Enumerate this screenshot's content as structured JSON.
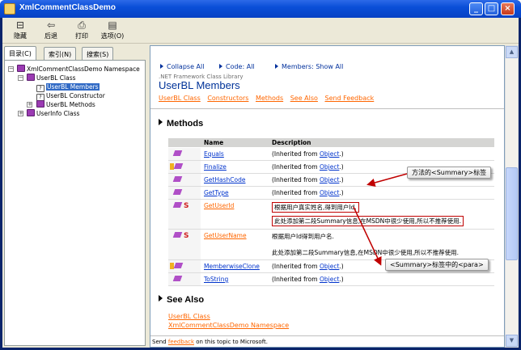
{
  "window": {
    "title": "XmlCommentClassDemo",
    "min": "_",
    "max": "□",
    "close": "×"
  },
  "toolbar": [
    {
      "label": "隐藏",
      "icon": "hide-icon",
      "glyph": "⊟"
    },
    {
      "label": "后退",
      "icon": "back-icon",
      "glyph": "⇦"
    },
    {
      "label": "打印",
      "icon": "print-icon",
      "glyph": "⎙"
    },
    {
      "label": "选项(O)",
      "icon": "options-icon",
      "glyph": "▤"
    }
  ],
  "left": {
    "tabs": [
      "目录(C)",
      "索引(N)",
      "搜索(S)"
    ],
    "tree": [
      {
        "label": "XmlCommentClassDemo Namespace",
        "toggle": "−",
        "icon": "book"
      },
      {
        "label": "UserBL Class",
        "toggle": "−",
        "icon": "book"
      },
      {
        "label": "UserBL Members",
        "toggle": "",
        "icon": "page"
      },
      {
        "label": "UserBL Constructor",
        "toggle": "",
        "icon": "page"
      },
      {
        "label": "UserBL Methods",
        "toggle": "+",
        "icon": "book"
      },
      {
        "label": "UserInfo Class",
        "toggle": "+",
        "icon": "book"
      }
    ]
  },
  "doc": {
    "controls": [
      "Collapse All",
      "Code: All",
      "Members: Show All"
    ],
    "library": ".NET Framework Class Library",
    "title": "UserBL Members",
    "jump_links": [
      "UserBL Class",
      "Constructors",
      "Methods",
      "See Also",
      "Send Feedback"
    ],
    "methods_heading": "Methods",
    "col_name": "Name",
    "col_desc": "Description",
    "methods": [
      {
        "name": "Equals",
        "desc_prefix": "(Inherited from ",
        "desc_link": "Object",
        "desc_suffix": ".)",
        "static": false,
        "protected": false,
        "visited": false
      },
      {
        "name": "Finalize",
        "desc_prefix": "(Inherited from ",
        "desc_link": "Object",
        "desc_suffix": ".)",
        "static": false,
        "protected": true,
        "visited": false
      },
      {
        "name": "GetHashCode",
        "desc_prefix": "(Inherited from ",
        "desc_link": "Object",
        "desc_suffix": ".)",
        "static": false,
        "protected": false,
        "visited": false
      },
      {
        "name": "GetType",
        "desc_prefix": "(Inherited from ",
        "desc_link": "Object",
        "desc_suffix": ".)",
        "static": false,
        "protected": false,
        "visited": false
      },
      {
        "name": "GetUserId",
        "desc_line1": "根据用户真实姓名,得到用户Id.",
        "desc_line2": "此处添加第二段Summary信息,在MSDN中很少使用,所以不推荐使用.",
        "static": true,
        "protected": false,
        "visited": true
      },
      {
        "name": "GetUserName",
        "desc_line1": "根据用户Id得到用户名.",
        "desc_line2": "此处添加第二段Summary信息,在MSDN中很少使用,所以不推荐使用.",
        "static": true,
        "protected": false,
        "visited": true
      },
      {
        "name": "MemberwiseClone",
        "desc_prefix": "(Inherited from ",
        "desc_link": "Object",
        "desc_suffix": ".)",
        "static": false,
        "protected": true,
        "visited": false
      },
      {
        "name": "ToString",
        "desc_prefix": "(Inherited from ",
        "desc_link": "Object",
        "desc_suffix": ".)",
        "static": false,
        "protected": false,
        "visited": false
      }
    ],
    "see_also_heading": "See Also",
    "see_also": [
      "UserBL Class",
      "XmlCommentClassDemo Namespace"
    ],
    "footer_prefix": "Send ",
    "footer_link": "feedback",
    "footer_suffix": " on this topic to Microsoft."
  },
  "annotations": {
    "summary": "方法的<Summary>标签",
    "para": "<Summary>标签中的<para>"
  },
  "colors": {
    "annotation_arrow": "#c00000",
    "link": "#0033cc",
    "visited_link": "#ff6600",
    "title_blue": "#003399"
  }
}
